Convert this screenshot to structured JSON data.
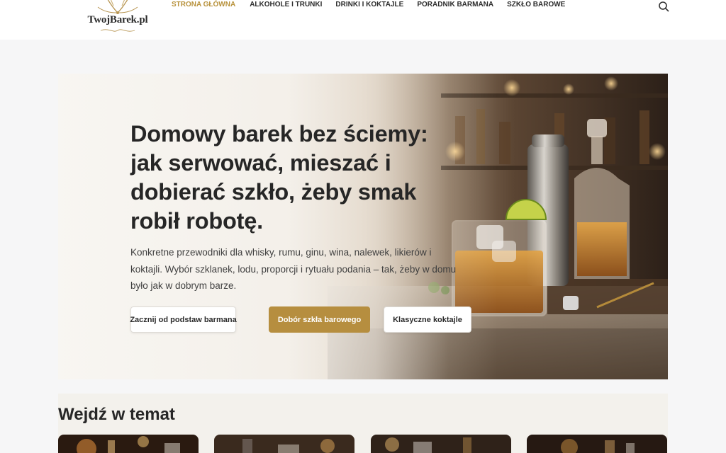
{
  "header": {
    "logo_text": "TwojBarek.pl",
    "nav": [
      {
        "label": "STRONA GŁÓWNA",
        "active": true
      },
      {
        "label": "ALKOHOLE I TRUNKI",
        "active": false
      },
      {
        "label": "DRINKI I KOKTAJLE",
        "active": false
      },
      {
        "label": "PORADNIK BARMANA",
        "active": false
      },
      {
        "label": "SZKŁO BAROWE",
        "active": false
      }
    ],
    "search_icon": "search-icon"
  },
  "hero": {
    "title": "Domowy barek bez ściemy: jak serwować, mieszać i dobierać szkło, żeby smak robił robotę.",
    "lead": "Konkretne przewodniki dla whisky, rumu, ginu, wina, nalewek, likierów i koktajli. Wybór szklanek, lodu, proporcji i rytuału podania – tak, żeby w domu było jak w dobrym barze.",
    "buttons": [
      {
        "label": "Zacznij od podstaw barmana",
        "style": "light"
      },
      {
        "label": "Dobór szkła barowego",
        "style": "gold"
      },
      {
        "label": "Klasyczne koktajle",
        "style": "light"
      }
    ]
  },
  "topics": {
    "title": "Wejdź w temat"
  },
  "colors": {
    "accent": "#b8923c",
    "button_gold": "#b68e3f",
    "text_dark": "#262626",
    "page_bg": "#f6f6f7",
    "section_bg": "#f3f1ec"
  }
}
